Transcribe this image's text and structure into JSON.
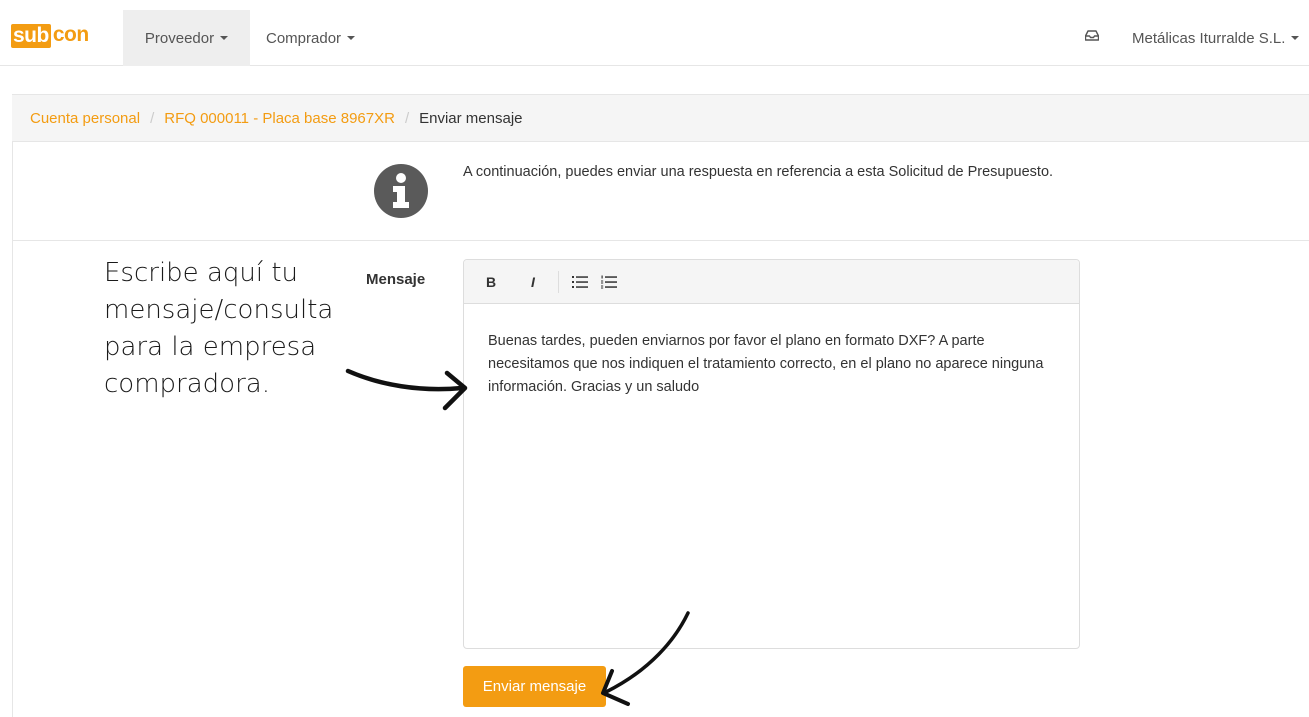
{
  "navbar": {
    "logo_sub": "sub",
    "logo_con": "con",
    "menu": [
      {
        "label": "Proveedor"
      },
      {
        "label": "Comprador"
      }
    ],
    "company": "Metálicas Iturralde S.L.",
    "icons": {
      "inbox": "inbox-icon",
      "caret": "chevron-down-icon"
    }
  },
  "breadcrumb": {
    "items": [
      {
        "label": "Cuenta personal"
      },
      {
        "label": "RFQ 000011 - Placa base 8967XR"
      },
      {
        "label": "Enviar mensaje"
      }
    ],
    "separator": "/"
  },
  "info": {
    "icon": "info-icon",
    "text": "A continuación, puedes enviar una respuesta en referencia a esta Solicitud de Presupuesto."
  },
  "form": {
    "label": "Mensaje",
    "toolbar": {
      "bold": "B",
      "italic": "I",
      "icons": [
        "unordered-list-icon",
        "ordered-list-icon"
      ]
    },
    "message": "Buenas tardes, pueden enviarnos por favor el plano en formato DXF? A parte necesitamos que nos indiquen el tratamiento correcto, en el plano no aparece ninguna información. Gracias y un saludo",
    "submit": "Enviar mensaje"
  },
  "annotation": {
    "text": "Escribe aquí tu mensaje/consulta para la empresa compradora."
  },
  "colors": {
    "accent": "#f39c12",
    "text": "#333333",
    "muted": "#555555",
    "border": "#e6e6e6",
    "breadcrumb_bg": "#f5f5f5"
  }
}
